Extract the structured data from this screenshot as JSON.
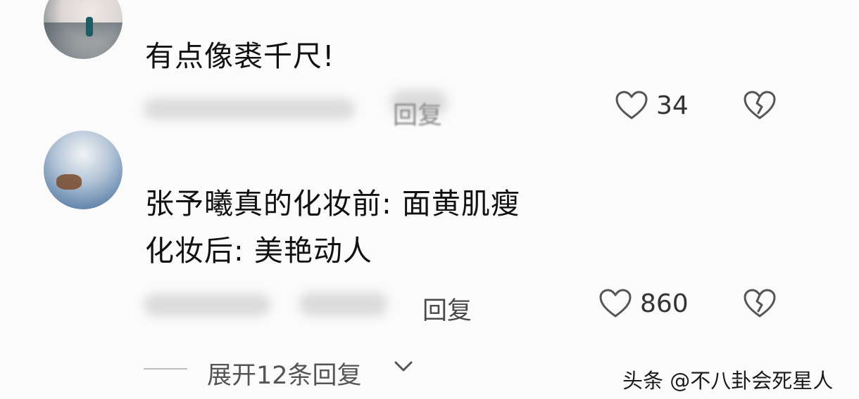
{
  "comments": [
    {
      "text_lines": [
        "有点像裘千尺!"
      ],
      "meta_obscured": true,
      "reply_label": "回复",
      "likes": "34"
    },
    {
      "text_lines": [
        "张予曦真的化妆前: 面黄肌瘦",
        "化妆后: 美艳动人"
      ],
      "meta_obscured": true,
      "reply_label": "回复",
      "likes": "860"
    }
  ],
  "expand_replies_label": "展开12条回复",
  "watermark": "头条 @不八卦会死星人",
  "icons": {
    "like": "heart-outline-icon",
    "dislike": "broken-heart-icon",
    "expand": "chevron-down-icon"
  },
  "colors": {
    "background": "#fbfbfb",
    "text": "#111111",
    "icon": "#555555",
    "muted": "#4a4a4a"
  }
}
